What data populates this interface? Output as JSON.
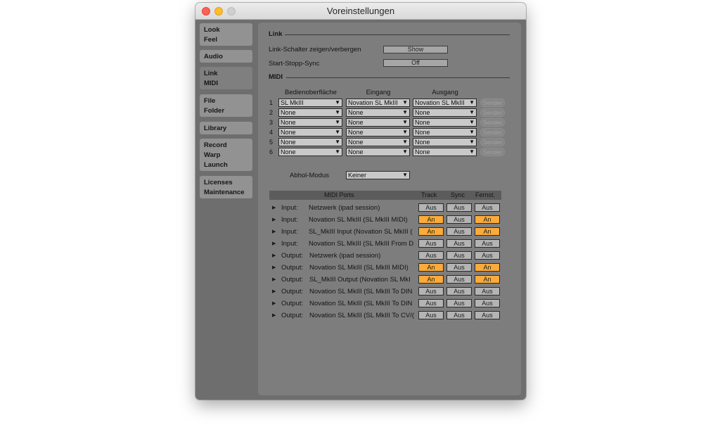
{
  "window": {
    "title": "Voreinstellungen"
  },
  "sidebar": {
    "tabs": [
      {
        "lines": [
          "Look",
          "Feel"
        ]
      },
      {
        "lines": [
          "Audio"
        ]
      },
      {
        "lines": [
          "Link",
          "MIDI"
        ]
      },
      {
        "lines": [
          "File",
          "Folder"
        ]
      },
      {
        "lines": [
          "Library"
        ]
      },
      {
        "lines": [
          "Record",
          "Warp",
          "Launch"
        ]
      },
      {
        "lines": [
          "Licenses",
          "Maintenance"
        ]
      }
    ],
    "active_index": 2
  },
  "link": {
    "heading": "Link",
    "show_label": "Link-Schalter zeigen/verbergen",
    "show_button": "Show",
    "sync_label": "Start-Stopp-Sync",
    "sync_button": "Off"
  },
  "midi": {
    "heading": "MIDI",
    "columns": [
      "Bedienoberfläche",
      "Eingang",
      "Ausgang"
    ],
    "sender_label": "Sender",
    "rows": [
      {
        "num": "1",
        "surface": "SL MkIII",
        "input": "Novation SL MkIII",
        "output": "Novation SL MkIII"
      },
      {
        "num": "2",
        "surface": "None",
        "input": "None",
        "output": "None"
      },
      {
        "num": "3",
        "surface": "None",
        "input": "None",
        "output": "None"
      },
      {
        "num": "4",
        "surface": "None",
        "input": "None",
        "output": "None"
      },
      {
        "num": "5",
        "surface": "None",
        "input": "None",
        "output": "None"
      },
      {
        "num": "6",
        "surface": "None",
        "input": "None",
        "output": "None"
      }
    ],
    "takeover_label": "Abhol-Modus",
    "takeover_value": "Keiner"
  },
  "ports": {
    "header": {
      "name": "MIDI Ports",
      "track": "Track",
      "sync": "Sync",
      "remote": "Fernst."
    },
    "rows": [
      {
        "dir": "Input:",
        "name": "Netzwerk (ipad session)",
        "track": "Aus",
        "sync": "Aus",
        "remote": "Aus"
      },
      {
        "dir": "Input:",
        "name": "Novation SL MkIII (SL MkIII MIDI)",
        "track": "An",
        "sync": "Aus",
        "remote": "An"
      },
      {
        "dir": "Input:",
        "name": "SL_MkIII Input (Novation SL MkIII (",
        "track": "An",
        "sync": "Aus",
        "remote": "An"
      },
      {
        "dir": "Input:",
        "name": "Novation SL MkIII (SL MkIII From D",
        "track": "Aus",
        "sync": "Aus",
        "remote": "Aus"
      },
      {
        "dir": "Output:",
        "name": "Netzwerk (ipad session)",
        "track": "Aus",
        "sync": "Aus",
        "remote": "Aus"
      },
      {
        "dir": "Output:",
        "name": "Novation SL MkIII (SL MkIII MIDI)",
        "track": "An",
        "sync": "Aus",
        "remote": "An"
      },
      {
        "dir": "Output:",
        "name": "SL_MkIII Output (Novation SL MkI",
        "track": "An",
        "sync": "Aus",
        "remote": "An"
      },
      {
        "dir": "Output:",
        "name": "Novation SL MkIII (SL MkIII To DIN",
        "track": "Aus",
        "sync": "Aus",
        "remote": "Aus"
      },
      {
        "dir": "Output:",
        "name": "Novation SL MkIII (SL MkIII To DIN",
        "track": "Aus",
        "sync": "Aus",
        "remote": "Aus"
      },
      {
        "dir": "Output:",
        "name": "Novation SL MkIII (SL MkIII To CV/(",
        "track": "Aus",
        "sync": "Aus",
        "remote": "Aus"
      }
    ]
  },
  "colors": {
    "toggle_on": "#fbab3b",
    "toggle_off": "#b4b4b4"
  }
}
